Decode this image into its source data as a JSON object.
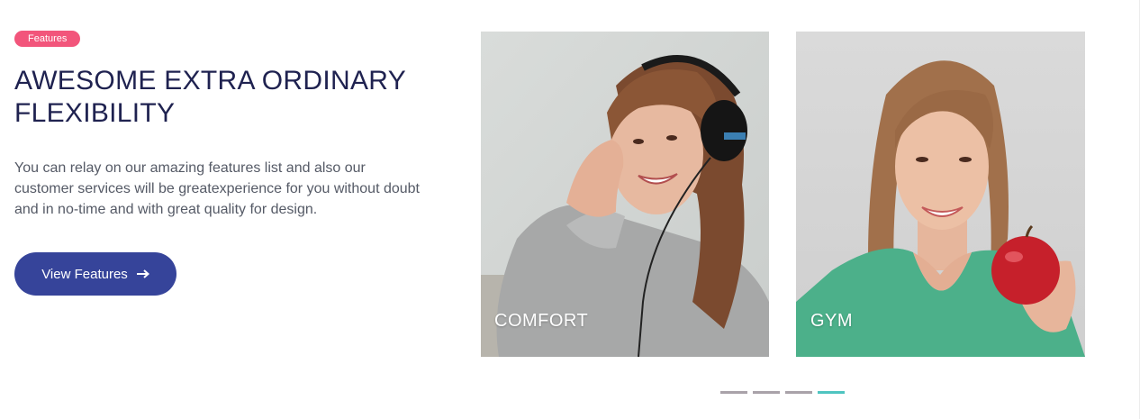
{
  "section": {
    "badge": "Features",
    "title": "AWESOME EXTRA ORDINARY FLEXIBILITY",
    "description": "You can relay on our amazing features list and also our customer services will be greatexperience for you without doubt and in no-time and with great quality for design.",
    "button_label": "View Features",
    "button_icon": "arrow-right-icon"
  },
  "cards": [
    {
      "label": "COMFORT",
      "image": "woman-with-headphones-photo"
    },
    {
      "label": "GYM",
      "image": "woman-holding-apple-photo"
    }
  ],
  "carousel": {
    "total_pages": 4,
    "active_page": 4
  },
  "colors": {
    "badge": "#f2557b",
    "title": "#1f2250",
    "button": "#36449a",
    "dot_inactive": "#a9a2a9",
    "dot_active": "#4fc4c0"
  }
}
